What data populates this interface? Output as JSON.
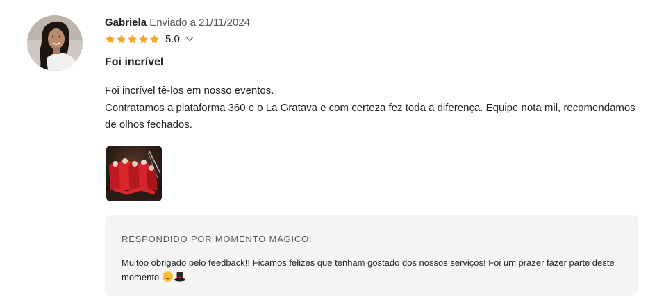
{
  "review": {
    "author": "Gabriela",
    "sent_label": "Enviado a 21/11/2024",
    "rating": 5,
    "rating_label": "5.0",
    "star_color": "#f5a623",
    "title": "Foi incrível",
    "body_lines": [
      "Foi incrível tê-los em nosso eventos.",
      "Contratamos a plataforma 360 e o La Gratava e com certeza fez toda a diferença. Equipe nota mil, recomendamos de olhos fechados."
    ],
    "icons": {
      "avatar": "profile-photo",
      "star": "star-icon",
      "expand": "chevron-down-icon",
      "photo": "event-photo-thumbnail"
    }
  },
  "reply": {
    "heading": "RESPONDIDO POR MOMENTO MÁGICO:",
    "text": "Muitoo obrigado pelo feedback!! Ficamos felizes que tenham gostado dos nossos serviços! Foi um prazer fazer parte deste momento",
    "emojis": [
      "smiling-face-icon",
      "top-hat-icon"
    ]
  }
}
